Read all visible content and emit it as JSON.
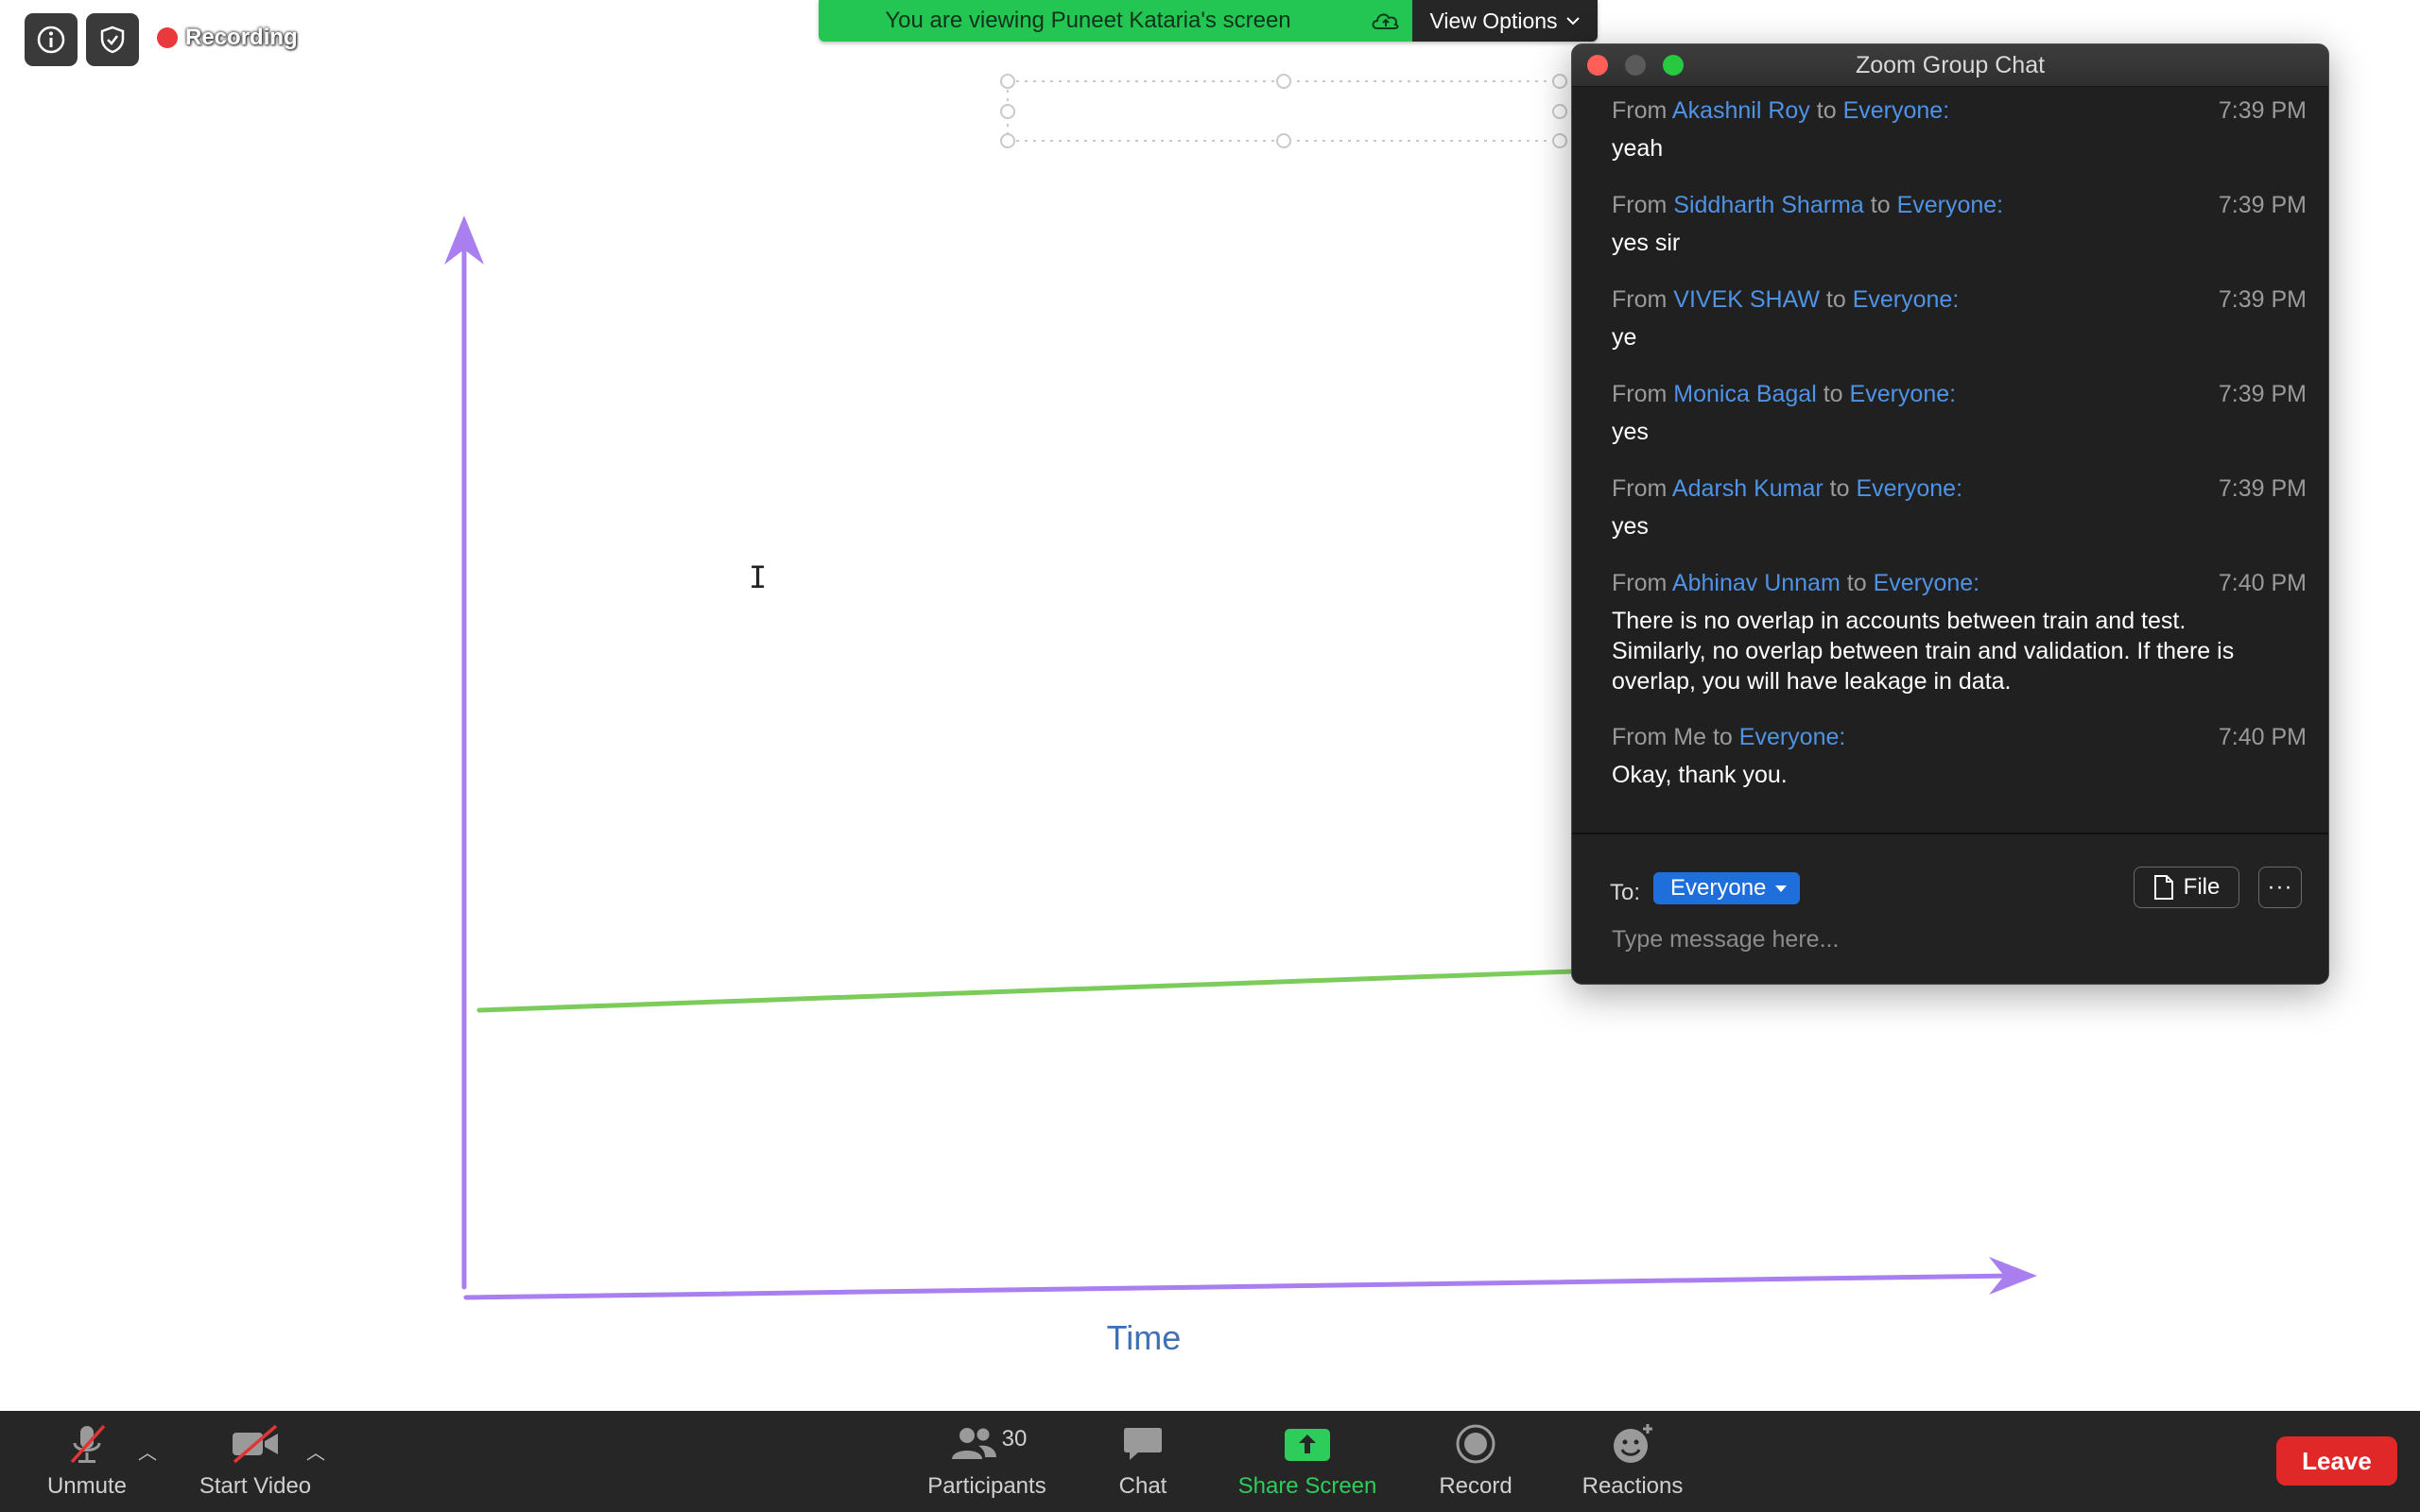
{
  "status": {
    "recording_label": "Recording"
  },
  "banner": {
    "viewing_text": "You are viewing Puneet Kataria's screen",
    "view_options_label": "View Options"
  },
  "whiteboard": {
    "axis_label": "Time",
    "colors": {
      "axes": "#a97ff0",
      "line": "#7ccc5c"
    }
  },
  "chat": {
    "title": "Zoom Group Chat",
    "from_word": "From",
    "to_word": "to",
    "messages": [
      {
        "sender": "Akashnil Roy",
        "recipient": "Everyone:",
        "time": "7:39 PM",
        "lines": [
          "yeah"
        ]
      },
      {
        "sender": "Siddharth Sharma",
        "recipient": "Everyone:",
        "time": "7:39 PM",
        "lines": [
          "yes sir"
        ]
      },
      {
        "sender": "VIVEK SHAW",
        "recipient": "Everyone:",
        "time": "7:39 PM",
        "lines": [
          "ye"
        ]
      },
      {
        "sender": "Monica Bagal",
        "recipient": "Everyone:",
        "time": "7:39 PM",
        "lines": [
          "yes"
        ]
      },
      {
        "sender": "Adarsh Kumar",
        "recipient": "Everyone:",
        "time": "7:39 PM",
        "lines": [
          "yes"
        ]
      },
      {
        "sender": "Abhinav Unnam",
        "recipient": "Everyone:",
        "time": "7:40 PM",
        "lines": [
          "There is no overlap in accounts between train and test.",
          "Similarly, no overlap between train and validation. If there is",
          "overlap, you will have leakage in data."
        ]
      },
      {
        "sender": "Me",
        "recipient": "Everyone:",
        "time": "7:40 PM",
        "lines": [
          "Okay, thank you."
        ]
      }
    ],
    "to_label": "To:",
    "to_value": "Everyone",
    "file_label": "File",
    "more_label": "···",
    "input_placeholder": "Type message here..."
  },
  "toolbar": {
    "unmute": "Unmute",
    "start_video": "Start Video",
    "participants": "Participants",
    "participants_count": "30",
    "chat": "Chat",
    "share_screen": "Share Screen",
    "record": "Record",
    "reactions": "Reactions",
    "leave": "Leave"
  },
  "icons": {
    "info": "info-icon",
    "security": "shield-icon",
    "record_dot": "record-dot-icon",
    "cloud": "cloud-icon",
    "chevron": "chevron-down-icon",
    "mic_muted": "mic-muted-icon",
    "video_off": "video-off-icon",
    "participants": "participants-icon",
    "chat": "chat-bubble-icon",
    "share": "share-screen-icon",
    "record": "record-icon",
    "reactions": "smiley-icon"
  },
  "colors": {
    "banner_green": "#23c553",
    "link_blue": "#4f93e6",
    "select_blue": "#1e6fdc",
    "leave_red": "#e02828",
    "share_green": "#2ecc5a",
    "toolbar_bg": "#262626"
  }
}
